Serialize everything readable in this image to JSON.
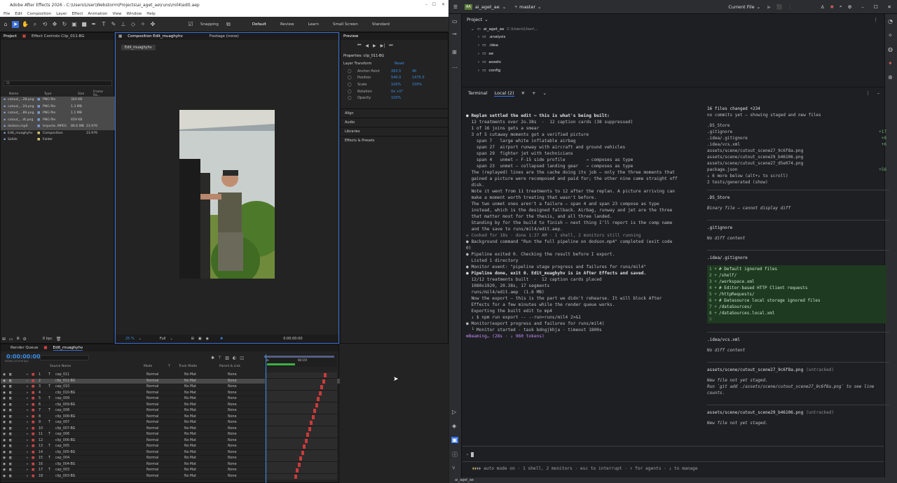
{
  "ae": {
    "title": "Adobe After Effects 2026 - C:\\Users\\User\\Webstorm\\Projects\\ai_aget_ae\\runs\\mil4\\edit.aep",
    "menu": [
      "File",
      "Edit",
      "Composition",
      "Layer",
      "Effect",
      "Animation",
      "View",
      "Window",
      "Help"
    ],
    "toolbar": {
      "snapping": "Snapping",
      "workspaces": [
        "Default",
        "Review",
        "Learn",
        "Small Screen",
        "Standard"
      ]
    },
    "project": {
      "tab": "Project",
      "effect_tab": "Effect Controls Clip_011-BG",
      "search_placeholder": "Q:",
      "headers": [
        "Name",
        "Type",
        "Size",
        "Frame Ra..."
      ],
      "items": [
        {
          "name": "cutout_...28.png",
          "type": "PNG file",
          "size": "320 KB",
          "color": "#7a9bd6"
        },
        {
          "name": "cutout_...24.png",
          "type": "PNG file",
          "size": "1.3 MB",
          "color": "#7a9bd6"
        },
        {
          "name": "cutout_...89.png",
          "type": "PNG file",
          "size": "1.1 MB",
          "color": "#7a9bd6"
        },
        {
          "name": "cutout_...dt.png",
          "type": "PNG file",
          "size": "659 KB",
          "color": "#7a9bd6"
        },
        {
          "name": "dodson.mp4",
          "type": "Importe..MPEG",
          "size": "86.6 MB",
          "frame": "23.976",
          "color": "#7a9bd6"
        },
        {
          "name": "Edit_muaghyhv",
          "type": "Composition",
          "size": "",
          "frame": "23.976",
          "color": "#d8c76a"
        },
        {
          "name": "Solids",
          "type": "Folder",
          "size": "",
          "color": "#d8c76a"
        }
      ],
      "bpc": "8 bpc"
    },
    "comp": {
      "tab": "Composition Edit_muaghyhv",
      "footage_tab": "Footage (none)",
      "crumb": "Edit_muaghyhv",
      "zoom": "25 %",
      "quality": "Full",
      "time": "0:00:00:00"
    },
    "preview": {
      "title": "Preview"
    },
    "properties": {
      "title": "Properties: clip_011-BG",
      "section": "Layer Transform",
      "reset": "Reset",
      "props": [
        {
          "label": "Anchor Point",
          "v1": "283.5",
          "v2": "40"
        },
        {
          "label": "Position",
          "v1": "540.0",
          "v2": "1475.0"
        },
        {
          "label": "Scale",
          "v1": "100%",
          "v2": "100%"
        },
        {
          "label": "Rotation",
          "v1": "0x +0°",
          "v2": ""
        },
        {
          "label": "Opacity",
          "v1": "100%",
          "v2": ""
        }
      ],
      "panels": [
        "Align",
        "Audio",
        "Libraries",
        "Effects & Presets"
      ]
    },
    "timeline": {
      "tab_rq": "Render Queue",
      "tab_comp": "Edit_muaghyhv",
      "timecode": "0:00:00:00",
      "fps": "00000 (23.976 fps)",
      "headers": [
        "Source Name",
        "Mode",
        "T",
        "Track Matte",
        "Parent & Link"
      ],
      "ruler": [
        "0s",
        "00:15f"
      ],
      "layers": [
        {
          "n": "1",
          "t": "T",
          "name": "cap_011"
        },
        {
          "n": "2",
          "t": "",
          "name": "clip_011-BG"
        },
        {
          "n": "3",
          "t": "T",
          "name": "cap_010"
        },
        {
          "n": "4",
          "t": "",
          "name": "clip_010-BG"
        },
        {
          "n": "5",
          "t": "T",
          "name": "cap_009"
        },
        {
          "n": "6",
          "t": "",
          "name": "clip_009-BG"
        },
        {
          "n": "7",
          "t": "T",
          "name": "cap_008"
        },
        {
          "n": "8",
          "t": "",
          "name": "clip_008-BG"
        },
        {
          "n": "9",
          "t": "T",
          "name": "cap_007"
        },
        {
          "n": "10",
          "t": "",
          "name": "clip_007-BG"
        },
        {
          "n": "11",
          "t": "T",
          "name": "cap_006"
        },
        {
          "n": "12",
          "t": "",
          "name": "clip_006-BG"
        },
        {
          "n": "13",
          "t": "T",
          "name": "cap_005"
        },
        {
          "n": "14",
          "t": "",
          "name": "clip_005-BG"
        },
        {
          "n": "15",
          "t": "T",
          "name": "cap_004"
        },
        {
          "n": "16",
          "t": "",
          "name": "clip_004-BG"
        },
        {
          "n": "17",
          "t": "T",
          "name": "cap_003"
        },
        {
          "n": "18",
          "t": "",
          "name": "clip_003-BG"
        }
      ],
      "mode": "Normal",
      "matte": "No Mat",
      "parent": "None"
    }
  },
  "ij": {
    "project": "ai_aget_ae",
    "branch": "master",
    "run_config": "Current File",
    "tree": {
      "title": "Project",
      "root": "ai_aget_ae",
      "root_path": "C:\\Users\\User\\...",
      "items": [
        ".analysis",
        ".idea",
        "ae",
        "assets",
        "config"
      ]
    },
    "terminal": {
      "tab": "Terminal",
      "local": "Local (2)",
      "lines": [
        {
          "c": "bold",
          "t": "● Replan settled the edit — this is what's being built:"
        },
        {
          "c": "",
          "t": ""
        },
        {
          "c": "",
          "t": "  12 treatments over 2o.38s  ·  12 caption cards (38 suppressed)"
        },
        {
          "c": "",
          "t": "  1 of 16 joins gets a smear"
        },
        {
          "c": "",
          "t": "  3 of 5 cutaway moments got a verified picture"
        },
        {
          "c": "",
          "t": "    span 7   large white inflatable airbag"
        },
        {
          "c": "",
          "t": "    span 27  airport runway with aircraft and ground vehicles"
        },
        {
          "c": "",
          "t": "    span 29  fighter jet with technicians"
        },
        {
          "c": "",
          "t": "    span 4   unmet — F-15 side profile        → composes as type"
        },
        {
          "c": "",
          "t": "    span 23  unmet — collapsed landing gear   → composes as type"
        },
        {
          "c": "",
          "t": ""
        },
        {
          "c": "",
          "t": "  The (replayed) lines are the cache doing its job — only the three moments that"
        },
        {
          "c": "",
          "t": "  gained a picture were recomposed and paid for; the other nine came straight off"
        },
        {
          "c": "",
          "t": "  disk."
        },
        {
          "c": "",
          "t": ""
        },
        {
          "c": "",
          "t": "  Note it went from 11 treatments to 12 after the replan. A picture arriving can"
        },
        {
          "c": "",
          "t": "  make a moment worth treating that wasn't before."
        },
        {
          "c": "",
          "t": ""
        },
        {
          "c": "",
          "t": "  The two unmet ones aren't a failure — span 4 and span 23 compose as type"
        },
        {
          "c": "",
          "t": "  instead, which is the designed fallback. Airbag, runway and jet are the three"
        },
        {
          "c": "",
          "t": "  that matter most for the thesis, and all three landed."
        },
        {
          "c": "",
          "t": ""
        },
        {
          "c": "",
          "t": "  Standing by for the build to finish — next thing I'll report is the comp name"
        },
        {
          "c": "",
          "t": "  and the save to runs/mil4/edit.aep."
        },
        {
          "c": "",
          "t": ""
        },
        {
          "c": "dim",
          "t": "✢ Cooked for 18s · done 1:37 AM · 1 shell, 2 monitors still running"
        },
        {
          "c": "",
          "t": ""
        },
        {
          "c": "",
          "t": "● Background command \"Run the full pipeline on dodson.mp4\" completed (exit code"
        },
        {
          "c": "",
          "t": "0)"
        },
        {
          "c": "",
          "t": ""
        },
        {
          "c": "",
          "t": "● Pipeline exited 0. Checking the result before I export."
        },
        {
          "c": "",
          "t": ""
        },
        {
          "c": "",
          "t": "  Listed 1 directory"
        },
        {
          "c": "",
          "t": ""
        },
        {
          "c": "",
          "t": "● Monitor event: \"pipeline stage progress and failures for runs/mil4\""
        },
        {
          "c": "",
          "t": ""
        },
        {
          "c": "bold",
          "t": "● Pipeline done, exit 0. Edit_muaghyhv is in After Effects and saved."
        },
        {
          "c": "",
          "t": ""
        },
        {
          "c": "",
          "t": "  12/12 treatments built  ·  12 caption cards placed"
        },
        {
          "c": "",
          "t": "  1080x1920, 20.38s, 17 segments"
        },
        {
          "c": "",
          "t": "  runs/mil4/edit.aep  (1.6 MB)"
        },
        {
          "c": "",
          "t": ""
        },
        {
          "c": "",
          "t": "  Now the export — this is the part we didn't rehearse. It will block After"
        },
        {
          "c": "",
          "t": "  Effects for a few minutes while the render queue works."
        },
        {
          "c": "",
          "t": ""
        },
        {
          "c": "",
          "t": "  Exporting the built edit to mp4"
        },
        {
          "c": "",
          "t": "  ↓ $ npm run export -- --run=runs/mil4 2>&1"
        },
        {
          "c": "",
          "t": ""
        },
        {
          "c": "",
          "t": "● Monitor(export progress and failures for runs/mil4)"
        },
        {
          "c": "",
          "t": "  └ Monitor started · task bdngjkhja · timeout 1800s"
        },
        {
          "c": "",
          "t": ""
        },
        {
          "c": "purple",
          "t": "✻Beaming… (28s · ↓ 960 tokens)"
        }
      ],
      "status": "⏵⏵ auto mode on · 1 shell, 2 monitors · esc to interrupt · ↑ for agents · ↓ to manage"
    },
    "changes": {
      "summary": "16 files changed +234",
      "sub": "no commits yet — showing staged and new files",
      "files": [
        {
          "n": ".DS_Store",
          "s": ""
        },
        {
          "n": ".gitignore",
          "s": "+17"
        },
        {
          "n": ".idea/.gitignore",
          "s": "+8"
        },
        {
          "n": ".idea/vcs.xml",
          "s": "+6"
        },
        {
          "n": "assets/scene/cutout_scene27_9c6f8a.png",
          "s": ""
        },
        {
          "n": "assets/scene/cutout_scene29_b46106.png",
          "s": ""
        },
        {
          "n": "assets/scene/cutout_scene27_d5e074.png",
          "s": ""
        },
        {
          "n": "package.json",
          "s": "+56"
        }
      ],
      "more": "↓ 6 more below (alt+↓ to scroll)",
      "tests": "2 tests/generated (show)",
      "ds_title": ".DS_Store",
      "ds_note": "Binary file – cannot display diff",
      "gi_title": ".gitignore",
      "gi_note": "No diff content",
      "igi_title": ".idea/.gitignore",
      "igi_lines": [
        "# Default ignored files",
        "/shelf/",
        "/workspace.xml",
        "# Editor-based HTTP Client requests",
        "/httpRequests/",
        "# Datasource local storage ignored files",
        "/dataSources/",
        "/dataSources.local.xml"
      ],
      "vcs_title": ".idea/vcs.xml",
      "vcs_note": "No diff content",
      "c27_title": "assets/scene/cutout_scene27_9c6f8a.png",
      "c27_tag": "(untracked)",
      "c27_note1": "New file not yet staged.",
      "c27_note2": "Run `git add ./assets/scene/cutout_scene27_9c6f8a.png` to see line counts.",
      "c29_title": "assets/scene/cutout_scene29_b46106.png",
      "c29_tag": "(untracked)",
      "c29_note": "New file not yet staged."
    },
    "footer": "ai_aget_ae"
  }
}
